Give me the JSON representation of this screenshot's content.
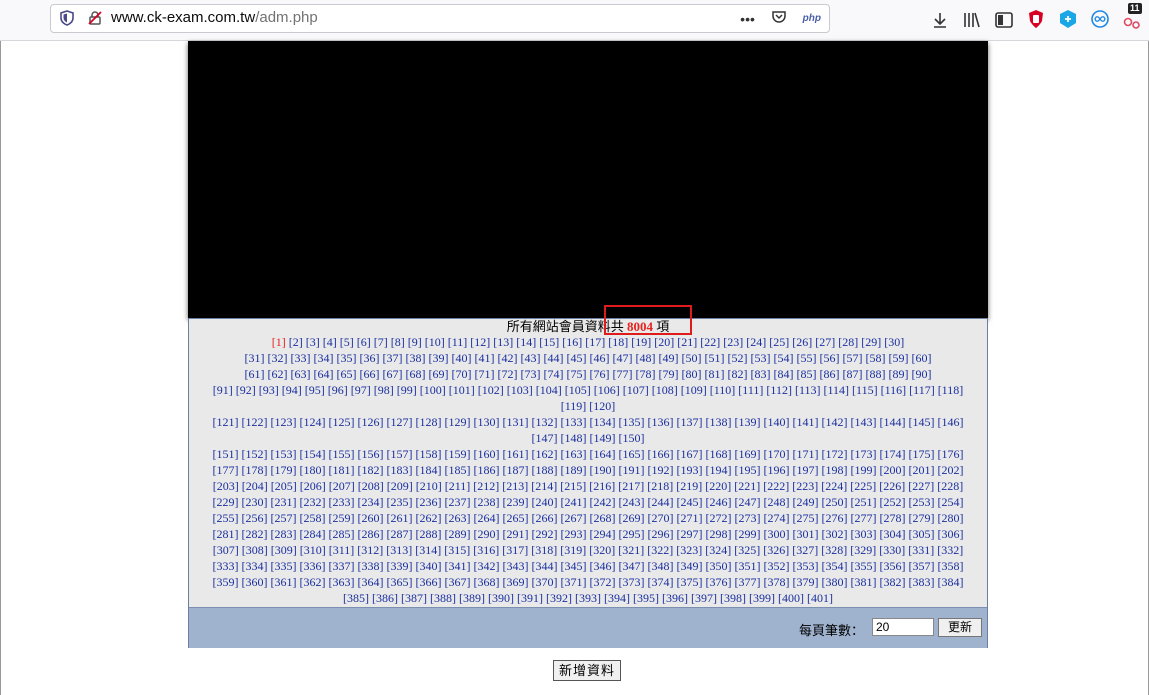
{
  "browser": {
    "url_host": "www.ck-exam.com.tw",
    "url_path": "/adm.php",
    "menu_dots": "•••",
    "php_badge": "php",
    "extension_badge": "11"
  },
  "summary": {
    "prefix": "所有網站會員資料共",
    "count": "8004",
    "suffix": "項"
  },
  "pagination": {
    "current": 1,
    "first": 1,
    "last": 401
  },
  "footer": {
    "per_page_label": "每頁筆數：",
    "per_page_value": "20",
    "update_label": "更新"
  },
  "add_button_label": "新增資料",
  "colors": {
    "link": "#1a2fa0",
    "current_page": "#e8231f",
    "footer_bar": "#9fb3cf",
    "highlight": "#e01b1b"
  }
}
